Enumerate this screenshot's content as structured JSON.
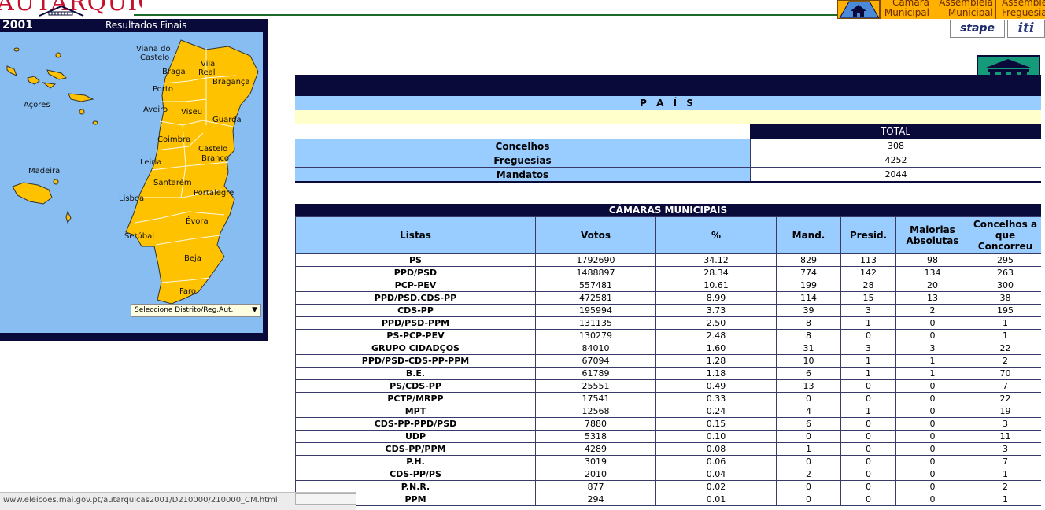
{
  "header": {
    "logo_text": "AUTARQUICAS",
    "year": "2001",
    "subtitle": "Resultados Finais"
  },
  "nav": {
    "tabs": [
      {
        "line1": "Câmara",
        "line2": "Municipal"
      },
      {
        "line1": "Assembleia",
        "line2": "Municipal"
      },
      {
        "line1": "Assembleia",
        "line2": "Freguesia"
      }
    ],
    "badges": {
      "stape": "stape",
      "iti": "iti"
    }
  },
  "map": {
    "labels": {
      "viana": "Viana do Castelo",
      "braga": "Braga",
      "vila_real": "Vila Real",
      "braganca": "Bragança",
      "porto": "Porto",
      "aveiro": "Aveiro",
      "viseu": "Viseu",
      "guarda": "Guarda",
      "coimbra": "Coimbra",
      "castelo_branco": "Castelo Branco",
      "leiria": "Leiria",
      "santarem": "Santarém",
      "portalegre": "Portalegre",
      "lisboa": "Lisboa",
      "evora": "Évora",
      "setubal": "Setúbal",
      "beja": "Beja",
      "faro": "Faro",
      "acores": "Açores",
      "madeira": "Madeira"
    },
    "select_label": "Seleccione Distrito/Reg.Aut.",
    "colors": {
      "ocean": "#87bdf0",
      "land": "#ffc200"
    }
  },
  "pais": {
    "title": "P A Í S",
    "total_header": "TOTAL",
    "rows": [
      {
        "label": "Concelhos",
        "value": "308"
      },
      {
        "label": "Freguesias",
        "value": "4252"
      },
      {
        "label": "Mandatos",
        "value": "2044"
      }
    ]
  },
  "camaras": {
    "title": "CÂMARAS MUNICIPAIS",
    "headers": [
      "Listas",
      "Votos",
      "%",
      "Mand.",
      "Presid.",
      "Maiorias Absolutas",
      "Concelhos a que Concorreu"
    ],
    "rows": [
      [
        "PS",
        "1792690",
        "34.12",
        "829",
        "113",
        "98",
        "295"
      ],
      [
        "PPD/PSD",
        "1488897",
        "28.34",
        "774",
        "142",
        "134",
        "263"
      ],
      [
        "PCP-PEV",
        "557481",
        "10.61",
        "199",
        "28",
        "20",
        "300"
      ],
      [
        "PPD/PSD.CDS-PP",
        "472581",
        "8.99",
        "114",
        "15",
        "13",
        "38"
      ],
      [
        "CDS-PP",
        "195994",
        "3.73",
        "39",
        "3",
        "2",
        "195"
      ],
      [
        "PPD/PSD-PPM",
        "131135",
        "2.50",
        "8",
        "1",
        "0",
        "1"
      ],
      [
        "PS-PCP-PEV",
        "130279",
        "2.48",
        "8",
        "0",
        "0",
        "1"
      ],
      [
        "GRUPO CIDADÇOS",
        "84010",
        "1.60",
        "31",
        "3",
        "3",
        "22"
      ],
      [
        "PPD/PSD-CDS-PP-PPM",
        "67094",
        "1.28",
        "10",
        "1",
        "1",
        "2"
      ],
      [
        "B.E.",
        "61789",
        "1.18",
        "6",
        "1",
        "1",
        "70"
      ],
      [
        "PS/CDS-PP",
        "25551",
        "0.49",
        "13",
        "0",
        "0",
        "7"
      ],
      [
        "PCTP/MRPP",
        "17541",
        "0.33",
        "0",
        "0",
        "0",
        "22"
      ],
      [
        "MPT",
        "12568",
        "0.24",
        "4",
        "1",
        "0",
        "19"
      ],
      [
        "CDS-PP-PPD/PSD",
        "7880",
        "0.15",
        "6",
        "0",
        "0",
        "3"
      ],
      [
        "UDP",
        "5318",
        "0.10",
        "0",
        "0",
        "0",
        "11"
      ],
      [
        "CDS-PP/PPM",
        "4289",
        "0.08",
        "1",
        "0",
        "0",
        "3"
      ],
      [
        "P.H.",
        "3019",
        "0.06",
        "0",
        "0",
        "0",
        "7"
      ],
      [
        "CDS-PP/PS",
        "2010",
        "0.04",
        "2",
        "0",
        "0",
        "1"
      ],
      [
        "P.N.R.",
        "877",
        "0.02",
        "0",
        "0",
        "0",
        "2"
      ],
      [
        "PPM",
        "294",
        "0.01",
        "0",
        "0",
        "0",
        "1"
      ]
    ]
  },
  "status_bar": {
    "url": "www.eleicoes.mai.gov.pt/autarquicas2001/D210000/210000_CM.html"
  }
}
